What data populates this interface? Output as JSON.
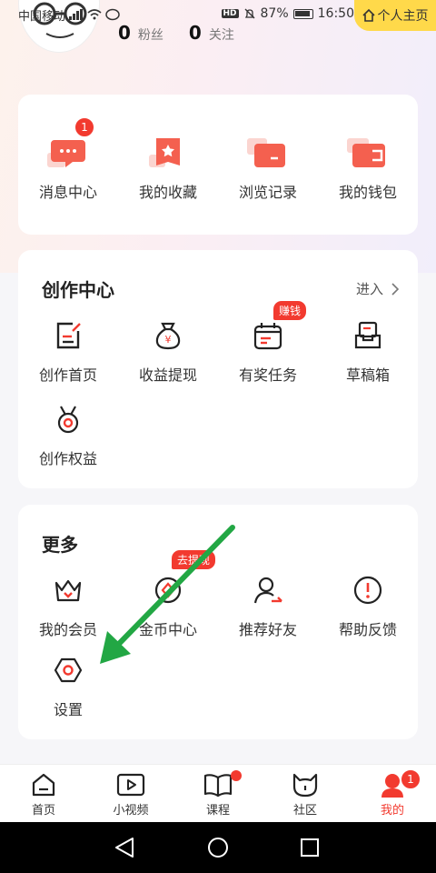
{
  "status": {
    "carrier": "中国移动",
    "battery": "87%",
    "time": "16:50"
  },
  "header": {
    "home_button": "个人主页",
    "fans_count": "0",
    "fans_label": "粉丝",
    "follow_count": "0",
    "follow_label": "关注"
  },
  "quick": {
    "items": [
      {
        "label": "消息中心",
        "icon": "message-icon",
        "badge": "1"
      },
      {
        "label": "我的收藏",
        "icon": "favorite-icon"
      },
      {
        "label": "浏览记录",
        "icon": "history-icon"
      },
      {
        "label": "我的钱包",
        "icon": "wallet-icon"
      }
    ]
  },
  "creation": {
    "title": "创作中心",
    "enter": "进入",
    "items": [
      {
        "label": "创作首页",
        "icon": "edit-icon"
      },
      {
        "label": "收益提现",
        "icon": "money-bag-icon"
      },
      {
        "label": "有奖任务",
        "icon": "calendar-icon",
        "tag": "赚钱"
      },
      {
        "label": "草稿箱",
        "icon": "draft-box-icon"
      },
      {
        "label": "创作权益",
        "icon": "medal-icon"
      }
    ]
  },
  "more": {
    "title": "更多",
    "items": [
      {
        "label": "我的会员",
        "icon": "crown-icon"
      },
      {
        "label": "金币中心",
        "icon": "coin-icon",
        "tag": "去提现"
      },
      {
        "label": "推荐好友",
        "icon": "invite-icon"
      },
      {
        "label": "帮助反馈",
        "icon": "help-icon"
      },
      {
        "label": "设置",
        "icon": "settings-icon"
      }
    ]
  },
  "tabbar": {
    "items": [
      {
        "label": "首页",
        "icon": "home-icon"
      },
      {
        "label": "小视频",
        "icon": "video-icon"
      },
      {
        "label": "课程",
        "icon": "book-icon"
      },
      {
        "label": "社区",
        "icon": "community-icon"
      },
      {
        "label": "我的",
        "icon": "profile-icon",
        "badge": "1",
        "active": true
      }
    ]
  },
  "colors": {
    "accent": "#f23a2f",
    "home_button": "#ffd94a",
    "annotation_arrow": "#22a744"
  }
}
